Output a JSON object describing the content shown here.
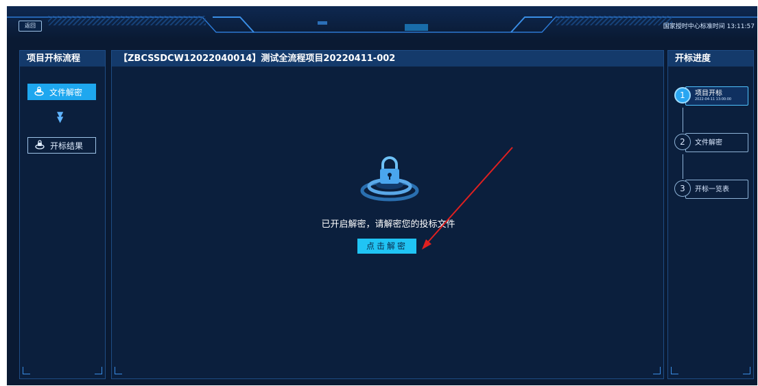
{
  "header": {
    "back_label": "返回",
    "clock": "国家授时中心标准时间 13:11:57"
  },
  "left_panel": {
    "title": "项目开标流程",
    "steps": [
      {
        "label": "文件解密",
        "state": "active",
        "icon": "lock-icon"
      },
      {
        "label": "开标结果",
        "state": "inactive",
        "icon": "lock-icon"
      }
    ]
  },
  "main": {
    "title": "【ZBCSSDCW12022040014】测试全流程项目20220411-002",
    "message": "已开启解密，请解密您的投标文件",
    "decrypt_button": "点击解密"
  },
  "right_panel": {
    "title": "开标进度",
    "steps": [
      {
        "number": "1",
        "label": "项目开标",
        "date": "2022-04-11 13:00:00",
        "state": "active"
      },
      {
        "number": "2",
        "label": "文件解密",
        "state": "pending"
      },
      {
        "number": "3",
        "label": "开标一览表",
        "state": "pending"
      }
    ]
  },
  "colors": {
    "background": "#0a1a33",
    "panel_header": "#143a6b",
    "accent": "#1ea7ef",
    "button": "#20c4f4",
    "annotation_arrow": "#e02020"
  }
}
